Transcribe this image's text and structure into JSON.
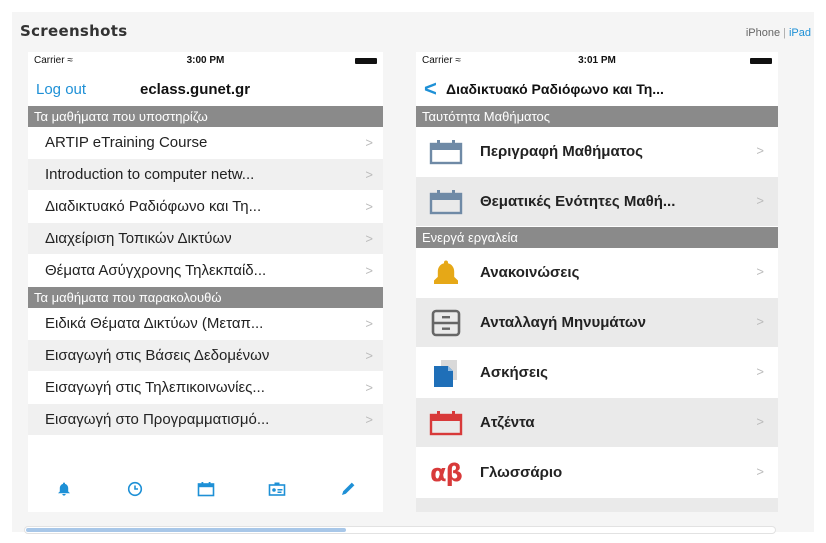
{
  "header": {
    "title": "Screenshots",
    "iphone_label": "iPhone",
    "ipad_label": "iPad"
  },
  "left_phone": {
    "status": {
      "carrier": "Carrier ≈",
      "time": "3:00 PM"
    },
    "nav": {
      "logout": "Log out",
      "title": "eclass.gunet.gr"
    },
    "section1": "Τα μαθήματα που υποστηρίζω",
    "section1_items": [
      "ARTIP eTraining Course",
      "Introduction to computer netw...",
      "Διαδικτυακό Ραδιόφωνο και Τη...",
      "Διαχείριση Τοπικών Δικτύων",
      "Θέματα Ασύγχρονης Τηλεκπαίδ..."
    ],
    "section2": "Τα μαθήματα που παρακολουθώ",
    "section2_items": [
      "Ειδικά Θέματα Δικτύων (Μεταπ...",
      "Εισαγωγή στις Βάσεις Δεδομένων",
      "Εισαγωγή στις Τηλεπικοινωνίες...",
      "Εισαγωγή στο Προγραμματισμό..."
    ],
    "chevron": ">"
  },
  "right_phone": {
    "status": {
      "carrier": "Carrier ≈",
      "time": "3:01 PM"
    },
    "nav": {
      "back": "<",
      "title": "Διαδικτυακό Ραδιόφωνο και Τη..."
    },
    "section1": "Ταυτότητα Μαθήματος",
    "section1_items": [
      "Περιγραφή Μαθήματος",
      "Θεματικές Ενότητες Μαθή..."
    ],
    "section2": "Ενεργά εργαλεία",
    "section2_items": [
      "Ανακοινώσεις",
      "Ανταλλαγή Μηνυμάτων",
      "Ασκήσεις",
      "Ατζέντα",
      "Γλωσσάριο"
    ],
    "glossary_icon_text": "αβ",
    "chevron": ">"
  },
  "colors": {
    "accent": "#1e90d6",
    "section_bg": "#8a8a8a",
    "bell": "#e6a817",
    "calendar_red": "#d83a3a"
  }
}
